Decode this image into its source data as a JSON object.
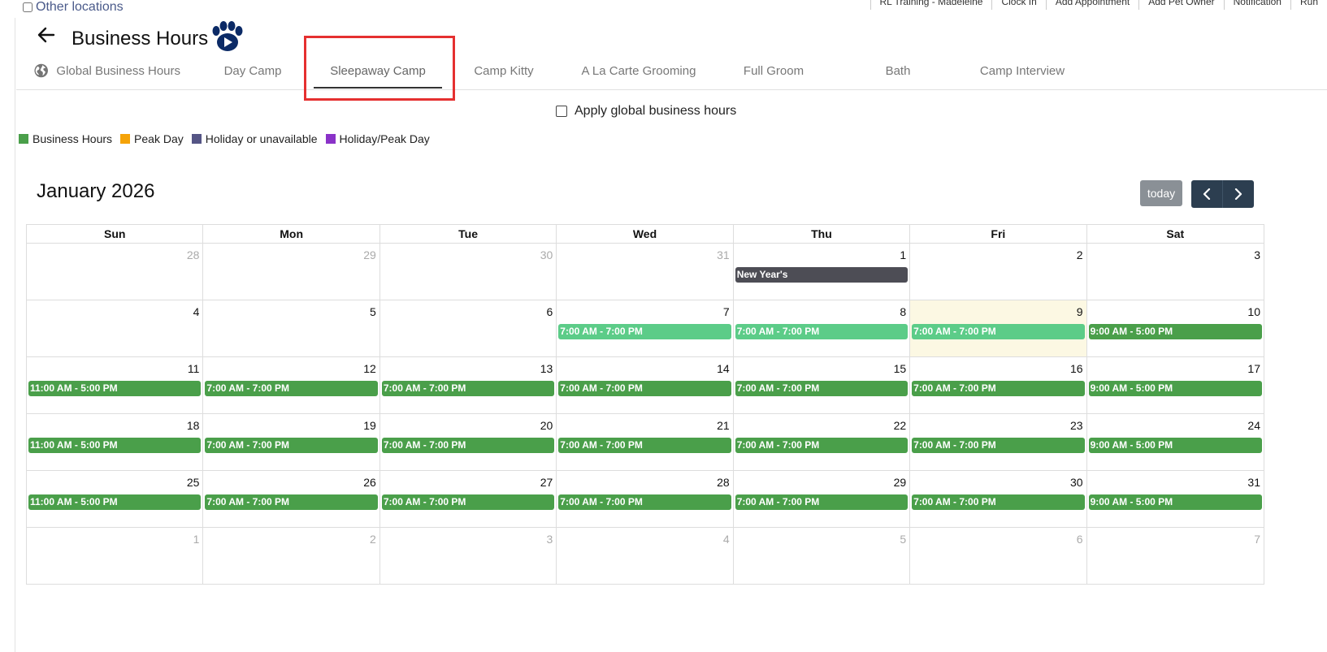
{
  "colors": {
    "business": "#4a9f4a",
    "business_light": "#5ccc88",
    "peak": "#f5a308",
    "holiday": "#555585",
    "holiday_peak": "#8a32c8",
    "holiday_event": "#4d4d55"
  },
  "top_left": {
    "other_locations": "Other locations"
  },
  "top_nav": [
    "RL Training - Madeleine",
    "Clock In",
    "Add Appointment",
    "Add Pet Owner",
    "Notification",
    "Run"
  ],
  "header": {
    "title": "Business Hours",
    "back_icon": "arrow-left-icon",
    "logo_icon": "paw-play-icon"
  },
  "tabs": [
    {
      "label": "Global Business Hours",
      "icon": "globe-icon"
    },
    {
      "label": "Day Camp"
    },
    {
      "label": "Sleepaway Camp",
      "active": true
    },
    {
      "label": "Camp Kitty"
    },
    {
      "label": "A La Carte Grooming"
    },
    {
      "label": "Full Groom"
    },
    {
      "label": "Bath"
    },
    {
      "label": "Camp Interview"
    }
  ],
  "apply_global_label": "Apply global business hours",
  "legend": [
    {
      "label": "Business Hours",
      "color": "#4a9f4a"
    },
    {
      "label": "Peak Day",
      "color": "#f5a308"
    },
    {
      "label": "Holiday or unavailable",
      "color": "#555585"
    },
    {
      "label": "Holiday/Peak Day",
      "color": "#8a32c8"
    }
  ],
  "calendar": {
    "title": "January 2026",
    "today_label": "today",
    "weekdays": [
      "Sun",
      "Mon",
      "Tue",
      "Wed",
      "Thu",
      "Fri",
      "Sat"
    ],
    "weeks": [
      [
        {
          "day": "28",
          "other": true
        },
        {
          "day": "29",
          "other": true
        },
        {
          "day": "30",
          "other": true
        },
        {
          "day": "31",
          "other": true
        },
        {
          "day": "1",
          "event": "New Year's",
          "kind": "holiday"
        },
        {
          "day": "2"
        },
        {
          "day": "3"
        }
      ],
      [
        {
          "day": "4"
        },
        {
          "day": "5"
        },
        {
          "day": "6"
        },
        {
          "day": "7",
          "event": "7:00 AM - 7:00 PM",
          "kind": "light"
        },
        {
          "day": "8",
          "event": "7:00 AM - 7:00 PM",
          "kind": "light"
        },
        {
          "day": "9",
          "event": "7:00 AM - 7:00 PM",
          "kind": "light",
          "today": true
        },
        {
          "day": "10",
          "event": "9:00 AM - 5:00 PM",
          "kind": "business"
        }
      ],
      [
        {
          "day": "11",
          "event": "11:00 AM - 5:00 PM",
          "kind": "business"
        },
        {
          "day": "12",
          "event": "7:00 AM - 7:00 PM",
          "kind": "business"
        },
        {
          "day": "13",
          "event": "7:00 AM - 7:00 PM",
          "kind": "business"
        },
        {
          "day": "14",
          "event": "7:00 AM - 7:00 PM",
          "kind": "business"
        },
        {
          "day": "15",
          "event": "7:00 AM - 7:00 PM",
          "kind": "business"
        },
        {
          "day": "16",
          "event": "7:00 AM - 7:00 PM",
          "kind": "business"
        },
        {
          "day": "17",
          "event": "9:00 AM - 5:00 PM",
          "kind": "business"
        }
      ],
      [
        {
          "day": "18",
          "event": "11:00 AM - 5:00 PM",
          "kind": "business"
        },
        {
          "day": "19",
          "event": "7:00 AM - 7:00 PM",
          "kind": "business"
        },
        {
          "day": "20",
          "event": "7:00 AM - 7:00 PM",
          "kind": "business"
        },
        {
          "day": "21",
          "event": "7:00 AM - 7:00 PM",
          "kind": "business"
        },
        {
          "day": "22",
          "event": "7:00 AM - 7:00 PM",
          "kind": "business"
        },
        {
          "day": "23",
          "event": "7:00 AM - 7:00 PM",
          "kind": "business"
        },
        {
          "day": "24",
          "event": "9:00 AM - 5:00 PM",
          "kind": "business"
        }
      ],
      [
        {
          "day": "25",
          "event": "11:00 AM - 5:00 PM",
          "kind": "business"
        },
        {
          "day": "26",
          "event": "7:00 AM - 7:00 PM",
          "kind": "business"
        },
        {
          "day": "27",
          "event": "7:00 AM - 7:00 PM",
          "kind": "business"
        },
        {
          "day": "28",
          "event": "7:00 AM - 7:00 PM",
          "kind": "business"
        },
        {
          "day": "29",
          "event": "7:00 AM - 7:00 PM",
          "kind": "business"
        },
        {
          "day": "30",
          "event": "7:00 AM - 7:00 PM",
          "kind": "business"
        },
        {
          "day": "31",
          "event": "9:00 AM - 5:00 PM",
          "kind": "business"
        }
      ],
      [
        {
          "day": "1",
          "other": true
        },
        {
          "day": "2",
          "other": true
        },
        {
          "day": "3",
          "other": true
        },
        {
          "day": "4",
          "other": true
        },
        {
          "day": "5",
          "other": true
        },
        {
          "day": "6",
          "other": true
        },
        {
          "day": "7",
          "other": true
        }
      ]
    ]
  }
}
